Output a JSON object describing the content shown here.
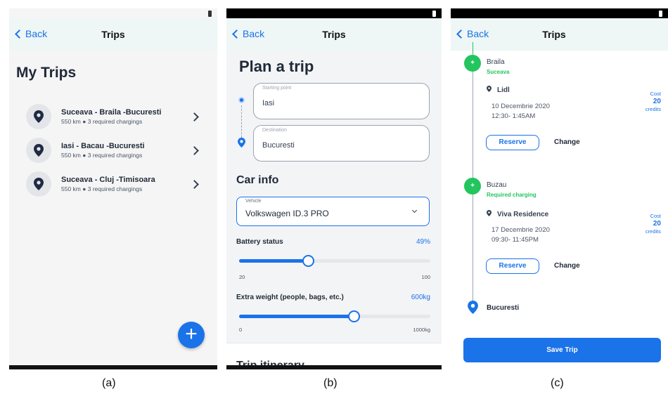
{
  "screen_a": {
    "back_label": "Back",
    "nav_title": "Trips",
    "heading": "My Trips",
    "trips": [
      {
        "title": "Suceava - Braila -Bucuresti",
        "distance": "550 km",
        "chargings": "3 required chargings"
      },
      {
        "title": "Iasi - Bacau -Bucuresti",
        "distance": "550 km",
        "chargings": "3 required chargings"
      },
      {
        "title": "Suceava - Cluj -Timisoara",
        "distance": "550 km",
        "chargings": "3 required chargings"
      }
    ],
    "add_button": "+"
  },
  "screen_b": {
    "back_label": "Back",
    "nav_title": "Trips",
    "heading": "Plan a trip",
    "starting_point": {
      "label": "Starting point",
      "value": "Iasi"
    },
    "destination": {
      "label": "Destination",
      "value": "Bucuresti"
    },
    "car_info_heading": "Car info",
    "vehicle": {
      "label": "Vehicle",
      "value": "Volkswagen ID.3 PRO"
    },
    "battery": {
      "label": "Battery status",
      "value_text": "49%",
      "min": "20",
      "max": "100",
      "fraction": 0.36
    },
    "weight": {
      "label": "Extra weight (people, bags, etc.)",
      "value_text": "600kg",
      "min": "0",
      "max": "1000kg",
      "fraction": 0.6
    },
    "itinerary_heading": "Trip itinerary"
  },
  "screen_c": {
    "back_label": "Back",
    "nav_title": "Trips",
    "stops": [
      {
        "city": "Braila",
        "sub": "Suceava",
        "station": "Lidl",
        "date": "10 Decembrie 2020",
        "time": "12:30- 1:45AM",
        "cost_label": "Cost",
        "cost_value": "20",
        "cost_unit": "credits",
        "reserve": "Reserve",
        "change": "Change"
      },
      {
        "city": "Buzau",
        "sub": "Required charging",
        "station": "Viva Residence",
        "date": "17 Decembrie 2020",
        "time": "09:30- 11:45PM",
        "cost_label": "Cost",
        "cost_value": "20",
        "cost_unit": "credits",
        "reserve": "Reserve",
        "change": "Change"
      }
    ],
    "destination": "Bucuresti",
    "save_button": "Save Trip"
  },
  "captions": [
    "(a)",
    "(b)",
    "(c)"
  ],
  "colors": {
    "accent": "#1a73e8",
    "green": "#22c55e",
    "nav_bg": "#eef6f6"
  }
}
